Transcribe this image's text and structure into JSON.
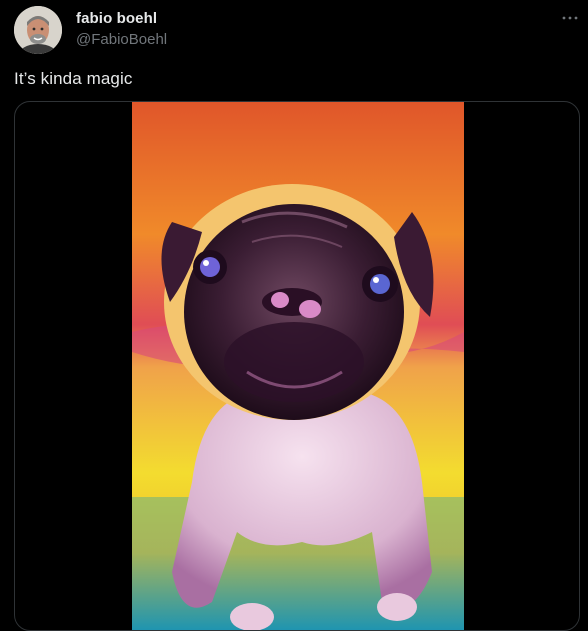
{
  "author": {
    "display_name": "fabio boehl",
    "handle": "@FabioBoehl"
  },
  "tweet": {
    "text": "It’s kinda magic"
  },
  "icons": {
    "more": "more-horizontal-icon"
  },
  "colors": {
    "background": "#000000",
    "primary_text": "#e7e9ea",
    "secondary_text": "#71767b",
    "border": "#2f3336"
  }
}
